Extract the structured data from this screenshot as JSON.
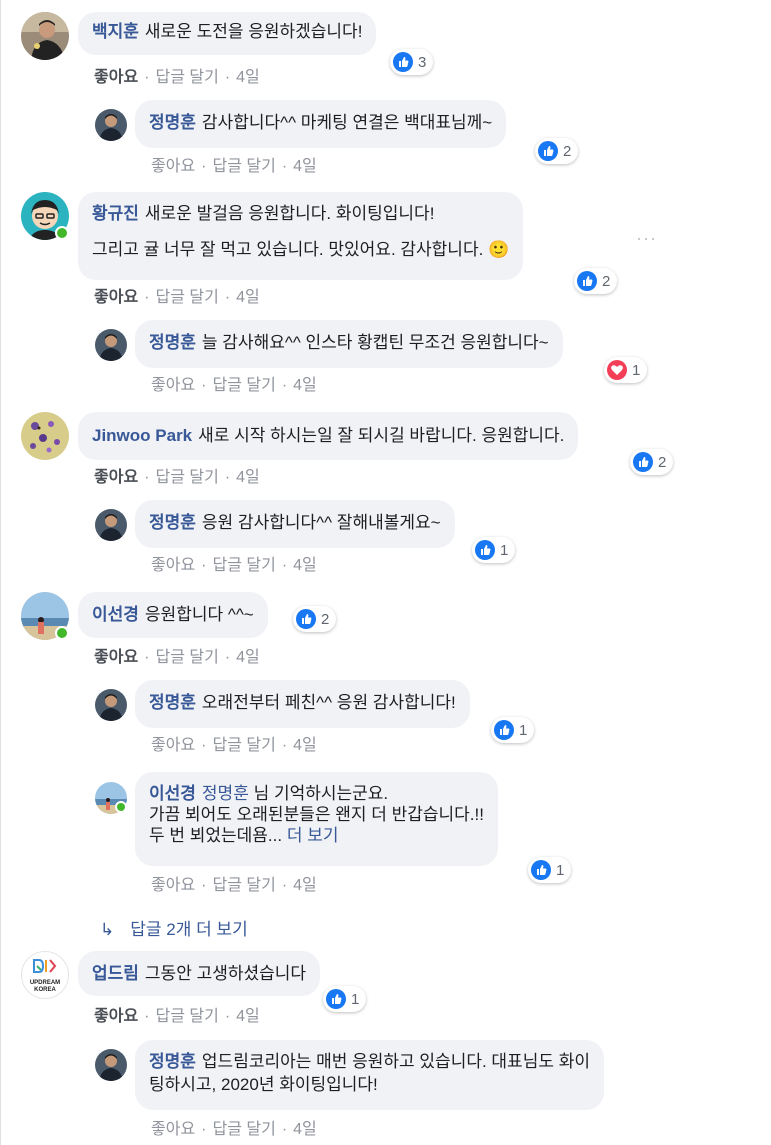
{
  "comments": [
    {
      "author": "백지훈",
      "text": "새로운 도전을 응원하겠습니다!",
      "reaction_icon": "like-icon",
      "reaction_count": "3",
      "like_label": "좋아요",
      "reply_label": "답글 달기",
      "time": "4일",
      "reply": {
        "author": "정명훈",
        "text": "감사합니다^^ 마케팅 연결은 백대표님께~",
        "reaction_icon": "like-icon",
        "reaction_count": "2",
        "like_label": "좋아요",
        "reply_label": "답글 달기",
        "time": "4일"
      }
    },
    {
      "author": "황규진",
      "text_line1": "새로운 발걸음 응원합니다. 화이팅입니다!",
      "text_line2": "그리고 귤 너무 잘 먹고 있습니다. 맛있어요. 감사합니다. 🙂",
      "reaction_icon": "like-icon",
      "reaction_count": "2",
      "like_label": "좋아요",
      "reply_label": "답글 달기",
      "time": "4일",
      "more_options": "···",
      "reply": {
        "author": "정명훈",
        "text": "늘 감사해요^^ 인스타 황캡틴 무조건 응원합니다~",
        "reaction_icon": "love-icon",
        "reaction_count": "1",
        "like_label": "좋아요",
        "reply_label": "답글 달기",
        "time": "4일"
      }
    },
    {
      "author": "Jinwoo Park",
      "text": "새로 시작 하시는일 잘 되시길 바랍니다. 응원합니다.",
      "reaction_icon": "like-icon",
      "reaction_count": "2",
      "like_label": "좋아요",
      "reply_label": "답글 달기",
      "time": "4일",
      "reply": {
        "author": "정명훈",
        "text": "응원 감사합니다^^ 잘해내볼게요~",
        "reaction_icon": "like-icon",
        "reaction_count": "1",
        "like_label": "좋아요",
        "reply_label": "답글 달기",
        "time": "4일"
      }
    },
    {
      "author": "이선경",
      "text": "응원합니다 ^^~",
      "reaction_icon": "like-icon",
      "reaction_count": "2",
      "like_label": "좋아요",
      "reply_label": "답글 달기",
      "time": "4일",
      "reply": {
        "author": "정명훈",
        "text": "오래전부터 페친^^ 응원 감사합니다!",
        "reaction_icon": "like-icon",
        "reaction_count": "1",
        "like_label": "좋아요",
        "reply_label": "답글 달기",
        "time": "4일"
      },
      "reply2": {
        "author": "이선경",
        "mention": "정명훈",
        "text_line1": "님 기억하시는군요.",
        "text_line2": "가끔 뵈어도 오래된분들은 왠지 더 반갑습니다.!!",
        "text_line3": "두 번 뵈었는데욤...",
        "see_more": "더 보기",
        "reaction_icon": "like-icon",
        "reaction_count": "1",
        "like_label": "좋아요",
        "reply_label": "답글 달기",
        "time": "4일"
      },
      "view_more_replies": "답글 2개 더 보기"
    },
    {
      "author": "업드림",
      "logo_text_line1": "UPDREAM",
      "logo_text_line2": "KOREA",
      "text": "그동안 고생하셨습니다",
      "reaction_icon": "like-icon",
      "reaction_count": "1",
      "like_label": "좋아요",
      "reply_label": "답글 달기",
      "time": "4일",
      "reply": {
        "author": "정명훈",
        "text_line1": "업드림코리아는 매번 응원하고 있습니다. 대표님도 화이",
        "text_line2": "팅하시고, 2020년 화이팅입니다!",
        "like_label": "좋아요",
        "reply_label": "답글 달기",
        "time": "4일"
      }
    }
  ],
  "colors": {
    "name_link": "#385898",
    "bubble_bg": "#f0f2f5",
    "meta_text": "#90949c",
    "like_blue": "#1877f2",
    "love_red": "#f33e58",
    "online_green": "#42b72a"
  }
}
